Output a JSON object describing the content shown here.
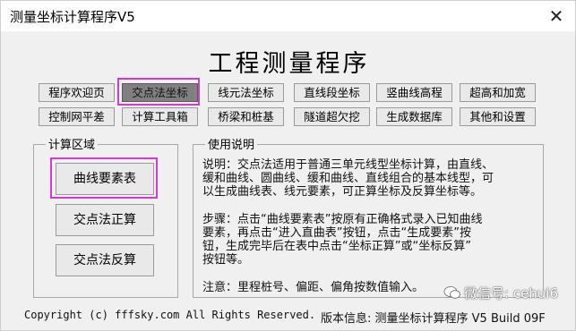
{
  "window": {
    "title": "测量坐标计算程序V5",
    "close_label": "✕"
  },
  "app": {
    "main_title": "工程测量程序"
  },
  "nav": {
    "row1": [
      "程序欢迎页",
      "交点法坐标",
      "线元法坐标",
      "直线段坐标",
      "竖曲线高程",
      "超高和加宽"
    ],
    "row2": [
      "控制网平差",
      "计算工具箱",
      "桥梁和桩基",
      "隧道超欠挖",
      "生成数据库",
      "其他和设置"
    ],
    "active": "交点法坐标"
  },
  "calc_area": {
    "legend": "计算区域",
    "buttons": [
      "曲线要素表",
      "交点法正算",
      "交点法反算"
    ]
  },
  "usage": {
    "legend": "使用说明",
    "lines": [
      "说明：交点法适用于普通三单元线型坐标计算，由直线、",
      "缓和曲线、圆曲线、缓和曲线、直线组合的基本线型，可",
      "以生成曲线表、线元要素，可正算坐标及反算坐标等。",
      "步骤：点击“曲线要素表”按原有正确格式录入已知曲线",
      "要素，再点击“进入直曲表”按钮，点击“生成要素”按",
      "钮，生成完毕后在表中点击“坐标正算”或“坐标反算”",
      "按钮等。",
      "注意：里程桩号、偏距、偏角按数值输入。"
    ]
  },
  "footer": {
    "copyright": "Copyright (c)  fffsky.com All Rights Reserved.",
    "version": "版本信息: 测量坐标计算程序 V5 Build 09F"
  },
  "watermark": {
    "text": "微信号: cehui6"
  },
  "colors": {
    "highlight": "#d23bd2",
    "active_button": "#808080",
    "background": "#f0f0f0"
  }
}
